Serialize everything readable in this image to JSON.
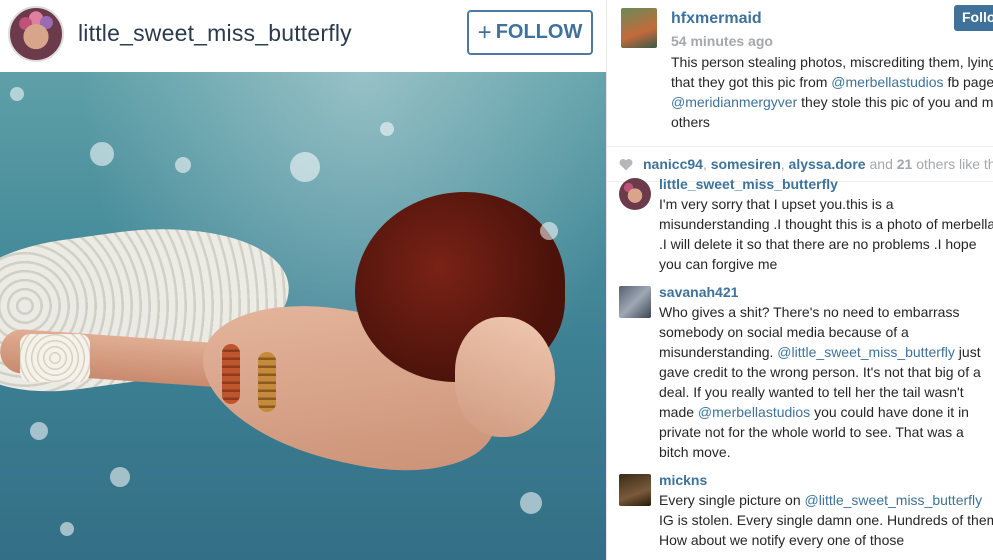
{
  "post": {
    "username": "little_sweet_miss_butterfly",
    "follow_label": "FOLLOW",
    "follow_plus": "+"
  },
  "caption": {
    "username": "hfxmermaid",
    "follow_label": "Follo",
    "time": "54 minutes ago",
    "lines": [
      [
        "This person stealing photos, miscrediting them, lying"
      ],
      [
        "that they got this pic from ",
        "@merbellastudios",
        " fb page."
      ],
      [
        "@meridianmergyver",
        " they stole this pic of you and ma"
      ],
      [
        "others"
      ]
    ]
  },
  "likes": {
    "users": [
      "nanicc94",
      "somesiren",
      "alyssa.dore"
    ],
    "and": "and",
    "count": "21",
    "suffix": "others like this."
  },
  "comments": [
    {
      "username": "little_sweet_miss_butterfly",
      "lines": [
        "I'm very sorry that I upset you.this is a",
        "misunderstanding .I thought this is a photo of merbella",
        ".I will delete it so that there are no problems .I hope",
        "you can forgive me"
      ]
    },
    {
      "username": "savanah421",
      "lines": [
        "Who gives a shit? There's no need to embarrass",
        "somebody on social media because of a",
        "misunderstanding. |@little_sweet_miss_butterfly| just",
        "gave credit to the wrong person. It's not that big of a",
        "deal. If you really wanted to tell her the tail wasn't",
        "made |@merbellastudios| you could have done it in",
        "private not for the whole world to see. That was a",
        "bitch move."
      ]
    },
    {
      "username": "mickns",
      "lines": [
        "Every single picture on |@little_sweet_miss_butterfly|",
        "IG is stolen. Every single damn one. Hundreds of them.",
        "How about we notify every one of those"
      ]
    }
  ],
  "colors": {
    "link": "#3f729b",
    "muted": "#a5a7aa",
    "text": "#262626"
  }
}
